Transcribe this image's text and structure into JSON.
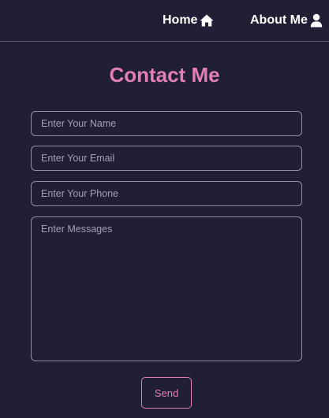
{
  "nav": {
    "home_label": "Home",
    "home_icon": "home-icon",
    "about_label": "About Me",
    "about_icon": "user-icon"
  },
  "contact": {
    "title": "Contact Me",
    "name_placeholder": "Enter Your Name",
    "email_placeholder": "Enter Your Email",
    "phone_placeholder": "Enter Your Phone",
    "message_placeholder": "Enter Messages",
    "send_label": "Send"
  },
  "colors": {
    "background": "#201f35",
    "accent": "#e47fb5",
    "text": "#ffffff",
    "field_border": "#8f91a8"
  }
}
